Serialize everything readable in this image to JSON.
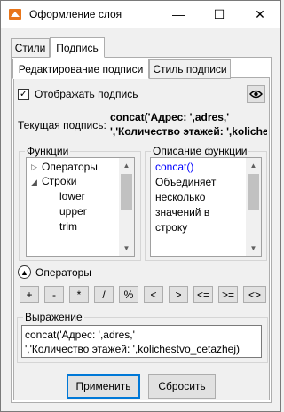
{
  "window": {
    "title": "Оформление слоя",
    "minimize_glyph": "—",
    "maximize_glyph": "☐",
    "close_glyph": "✕"
  },
  "tabs_main": [
    {
      "label": "Стили"
    },
    {
      "label": "Подпись",
      "active": true
    }
  ],
  "tabs_sub": [
    {
      "label": "Редактирование подписи",
      "active": true
    },
    {
      "label": "Стиль подписи"
    }
  ],
  "show_label": {
    "label": "Отображать подпись",
    "checked": true
  },
  "preview_icon": "eye-icon",
  "current_label": {
    "label": "Текущая подпись:",
    "line1": "concat('Адрес: ',adres,'",
    "line2": "','Количество этажей: ',kolicheste"
  },
  "functions": {
    "title": "Функции",
    "items": [
      {
        "label": "Операторы",
        "level": 0,
        "expander": "▷"
      },
      {
        "label": "Строки",
        "level": 0,
        "expander": "◢"
      },
      {
        "label": "lower",
        "level": 1
      },
      {
        "label": "upper",
        "level": 1
      },
      {
        "label": "trim",
        "level": 1
      }
    ]
  },
  "description": {
    "title": "Описание функции",
    "func_name": "concat()",
    "lines": [
      "Объединяет",
      "несколько",
      "значений в",
      "строку"
    ],
    "link_color": "#0000ff"
  },
  "operators": {
    "toggle_label": "Операторы",
    "buttons": [
      "+",
      "-",
      "*",
      "/",
      "%",
      "<",
      ">",
      "<=",
      ">=",
      "<>"
    ]
  },
  "expression": {
    "title": "Выражение",
    "value": "concat('Адрес: ',adres,'\n','Количество этажей: ',kolichestvo_cetazhej)"
  },
  "actions": {
    "apply": "Применить",
    "reset": "Сбросить"
  },
  "colors": {
    "accent": "#0078d7",
    "window_bg": "#f0f0f0",
    "icon_orange": "#e8751a"
  }
}
